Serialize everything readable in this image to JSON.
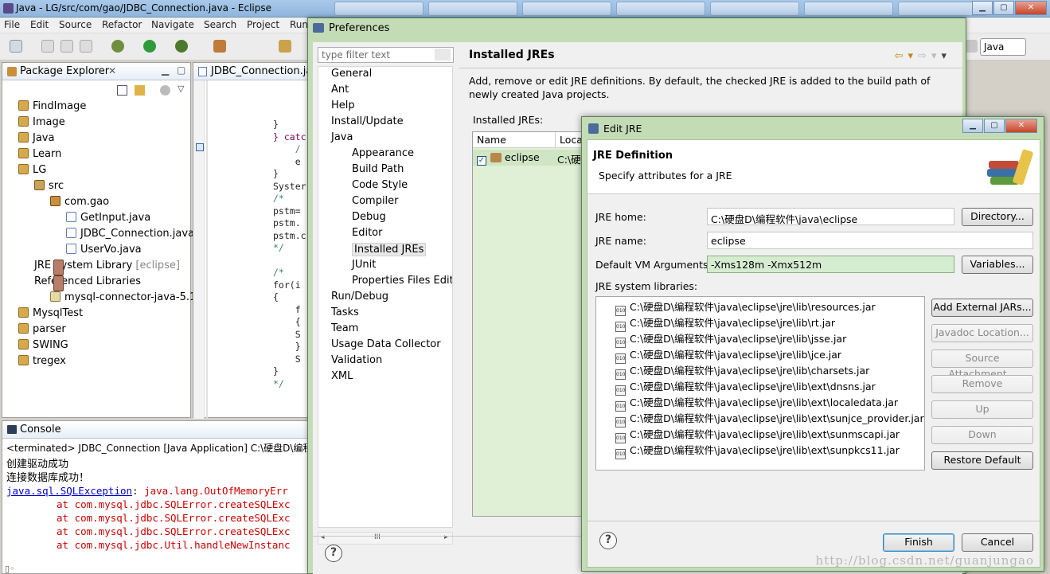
{
  "window": {
    "title": "Java - LG/src/com/gao/JDBC_Connection.java - Eclipse",
    "taskbar_items": [
      "",
      "",
      "",
      "",
      "",
      "",
      ""
    ]
  },
  "menu": [
    "File",
    "Edit",
    "Source",
    "Refactor",
    "Navigate",
    "Search",
    "Project",
    "Run"
  ],
  "perspective": "Java",
  "package_explorer": {
    "title": "Package Explorer",
    "items": [
      {
        "label": "FindImage",
        "icon": "project-icon"
      },
      {
        "label": "Image",
        "icon": "project-icon"
      },
      {
        "label": "Java",
        "icon": "project-icon"
      },
      {
        "label": "Learn",
        "icon": "project-icon"
      },
      {
        "label": "LG",
        "icon": "project-icon"
      },
      {
        "label": "src",
        "icon": "source-folder-icon"
      },
      {
        "label": "com.gao",
        "icon": "package-icon"
      },
      {
        "label": "GetInput.java",
        "icon": "java-file-icon"
      },
      {
        "label": "JDBC_Connection.java",
        "icon": "java-file-icon"
      },
      {
        "label": "UserVo.java",
        "icon": "java-file-icon"
      },
      {
        "label": "JRE System Library",
        "suffix": "[eclipse]",
        "icon": "library-icon"
      },
      {
        "label": "Referenced Libraries",
        "icon": "library-icon"
      },
      {
        "label": "mysql-connector-java-5.1.",
        "icon": "jar-icon"
      },
      {
        "label": "MysqlTest",
        "icon": "project-icon"
      },
      {
        "label": "parser",
        "icon": "project-icon"
      },
      {
        "label": "SWING",
        "icon": "project-icon"
      },
      {
        "label": "tregex",
        "icon": "project-icon"
      }
    ]
  },
  "editor": {
    "tab": "JDBC_Connection.jav",
    "lines": [
      "}",
      "} catc",
      "    /",
      "    e",
      "}",
      "Syster",
      "/*",
      "pstm=",
      "pstm.",
      "pstm.c",
      "*/",
      "",
      "/*",
      "for(i",
      "{",
      "    f",
      "    {",
      "    S",
      "    }",
      "    S",
      "}",
      "*/"
    ]
  },
  "console": {
    "title": "Console",
    "header": "<terminated> JDBC_Connection [Java Application] C:\\硬盘D\\编程软",
    "lines": [
      "创建驱动成功",
      "连接数据库成功！"
    ],
    "exception_class": "java.sql.SQLException",
    "exception_msg": "java.lang.OutOfMemoryErr",
    "stack": [
      "at com.mysql.jdbc.SQLError.createSQLExc",
      "at com.mysql.jdbc.SQLError.createSQLExc",
      "at com.mysql.jdbc.SQLError.createSQLExc",
      "at com.mysql.jdbc.Util.handleNewInstanc"
    ]
  },
  "preferences": {
    "title": "Preferences",
    "filter_placeholder": "type filter text",
    "tree": [
      {
        "label": "General",
        "level": 0
      },
      {
        "label": "Ant",
        "level": 0
      },
      {
        "label": "Help",
        "level": 0
      },
      {
        "label": "Install/Update",
        "level": 0
      },
      {
        "label": "Java",
        "level": 0
      },
      {
        "label": "Appearance",
        "level": 1
      },
      {
        "label": "Build Path",
        "level": 1
      },
      {
        "label": "Code Style",
        "level": 1
      },
      {
        "label": "Compiler",
        "level": 1
      },
      {
        "label": "Debug",
        "level": 1
      },
      {
        "label": "Editor",
        "level": 1
      },
      {
        "label": "Installed JREs",
        "level": 1,
        "selected": true
      },
      {
        "label": "JUnit",
        "level": 1
      },
      {
        "label": "Properties Files Edito",
        "level": 1
      },
      {
        "label": "Run/Debug",
        "level": 0
      },
      {
        "label": "Tasks",
        "level": 0
      },
      {
        "label": "Team",
        "level": 0
      },
      {
        "label": "Usage Data Collector",
        "level": 0
      },
      {
        "label": "Validation",
        "level": 0
      },
      {
        "label": "XML",
        "level": 0
      }
    ],
    "scrollbar_label": "III",
    "page_title": "Installed JREs",
    "description": "Add, remove or edit JRE definitions. By default, the checked JRE is added to the build path of newly created Java projects.",
    "installed_label": "Installed JREs:",
    "columns": [
      "Name",
      "Loca"
    ],
    "rows": [
      {
        "name": "eclipse",
        "location": "C:\\硬",
        "checked": true
      }
    ]
  },
  "edit_jre": {
    "title": "Edit JRE",
    "heading": "JRE Definition",
    "subheading": "Specify attributes for a JRE",
    "home_label": "JRE home:",
    "home_value": "C:\\硬盘D\\编程软件\\java\\eclipse",
    "directory_button": "Directory...",
    "name_label": "JRE name:",
    "name_value": "eclipse",
    "vmargs_label": "Default VM Arguments:",
    "vmargs_value": "-Xms128m -Xmx512m",
    "variables_button": "Variables...",
    "libs_label": "JRE system libraries:",
    "libraries": [
      "C:\\硬盘D\\编程软件\\java\\eclipse\\jre\\lib\\resources.jar",
      "C:\\硬盘D\\编程软件\\java\\eclipse\\jre\\lib\\rt.jar",
      "C:\\硬盘D\\编程软件\\java\\eclipse\\jre\\lib\\jsse.jar",
      "C:\\硬盘D\\编程软件\\java\\eclipse\\jre\\lib\\jce.jar",
      "C:\\硬盘D\\编程软件\\java\\eclipse\\jre\\lib\\charsets.jar",
      "C:\\硬盘D\\编程软件\\java\\eclipse\\jre\\lib\\ext\\dnsns.jar",
      "C:\\硬盘D\\编程软件\\java\\eclipse\\jre\\lib\\ext\\localedata.jar",
      "C:\\硬盘D\\编程软件\\java\\eclipse\\jre\\lib\\ext\\sunjce_provider.jar",
      "C:\\硬盘D\\编程软件\\java\\eclipse\\jre\\lib\\ext\\sunmscapi.jar",
      "C:\\硬盘D\\编程软件\\java\\eclipse\\jre\\lib\\ext\\sunpkcs11.jar"
    ],
    "side_buttons": [
      {
        "label": "Add External JARs...",
        "enabled": true
      },
      {
        "label": "Javadoc Location...",
        "enabled": false
      },
      {
        "label": "Source Attachment...",
        "enabled": false
      },
      {
        "label": "Remove",
        "enabled": false
      },
      {
        "label": "Up",
        "enabled": false
      },
      {
        "label": "Down",
        "enabled": false
      },
      {
        "label": "Restore Default",
        "enabled": true
      }
    ],
    "finish_button": "Finish",
    "cancel_button": "Cancel",
    "watermark": "http://blog.csdn.net/guanjungao"
  }
}
